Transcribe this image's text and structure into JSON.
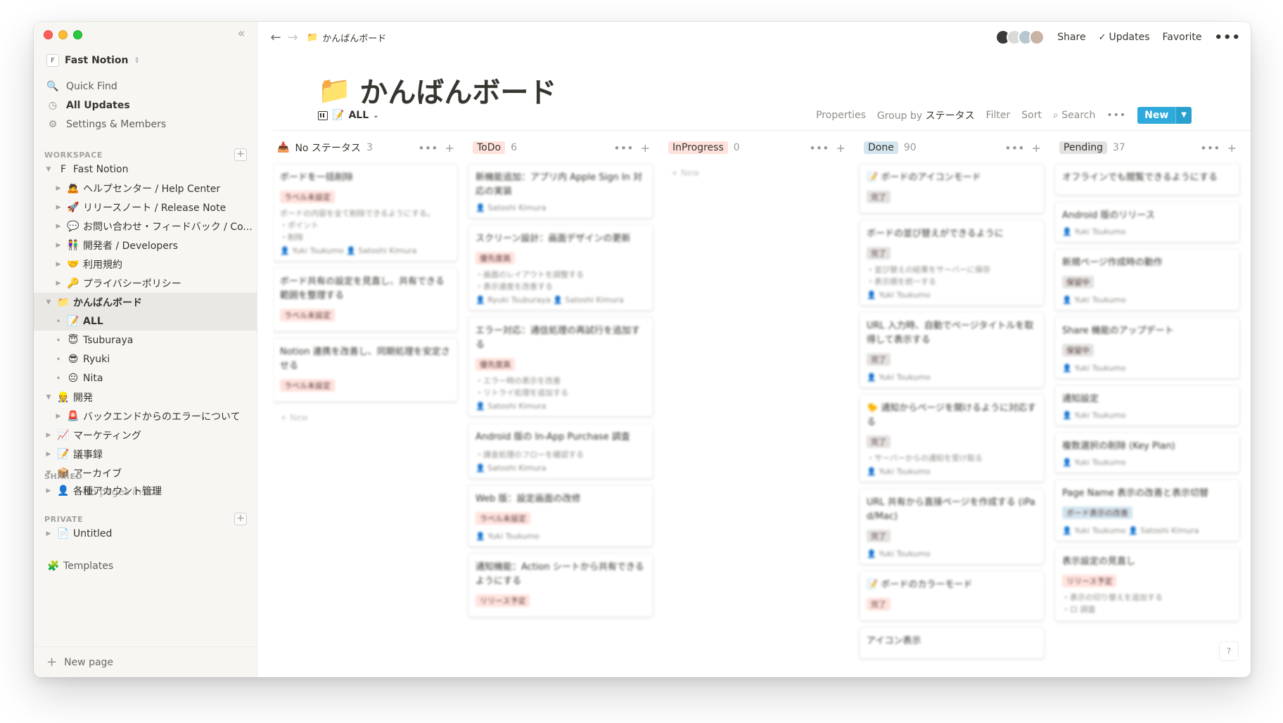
{
  "sidebar": {
    "workspace_name": "Fast Notion",
    "nav": [
      {
        "icon": "search-icon",
        "glyph": "🔍",
        "label": "Quick Find",
        "active": false
      },
      {
        "icon": "clock-icon",
        "glyph": "◷",
        "label": "All Updates",
        "active": true
      },
      {
        "icon": "gear-icon",
        "glyph": "⚙",
        "label": "Settings & Members",
        "active": false
      }
    ],
    "workspace_label": "WORKSPACE",
    "shared_label": "SHARED",
    "private_label": "PRIVATE",
    "tree": [
      {
        "level": 0,
        "toggle": "▼",
        "icon": "F",
        "label": "Fast Notion"
      },
      {
        "level": 1,
        "toggle": "▶",
        "icon": "🙇",
        "label": "ヘルプセンター / Help Center"
      },
      {
        "level": 1,
        "toggle": "▶",
        "icon": "🚀",
        "label": "リリースノート / Release Note"
      },
      {
        "level": 1,
        "toggle": "▶",
        "icon": "💬",
        "label": "お問い合わせ・フィードバック / Co..."
      },
      {
        "level": 1,
        "toggle": "▶",
        "icon": "👫",
        "label": "開発者 / Developers"
      },
      {
        "level": 1,
        "toggle": "▶",
        "icon": "🤝",
        "label": "利用規約"
      },
      {
        "level": 1,
        "toggle": "▶",
        "icon": "🔑",
        "label": "プライバシーポリシー"
      },
      {
        "level": 0,
        "toggle": "▼",
        "icon": "📁",
        "label": "かんばんボード",
        "bold": true,
        "selected": true
      },
      {
        "level": 1,
        "bullet": true,
        "icon": "📝",
        "label": "ALL",
        "bold": true,
        "selected": true
      },
      {
        "level": 1,
        "bullet": true,
        "icon": "😇",
        "label": "Tsuburaya"
      },
      {
        "level": 1,
        "bullet": true,
        "icon": "😎",
        "label": "Ryuki"
      },
      {
        "level": 1,
        "bullet": true,
        "icon": "😐",
        "label": "Nita"
      },
      {
        "level": 0,
        "toggle": "▼",
        "icon": "👷",
        "label": "開発"
      },
      {
        "level": 1,
        "toggle": "▶",
        "icon": "🚨",
        "label": "バックエンドからのエラーについて"
      },
      {
        "level": 0,
        "toggle": "▶",
        "icon": "📈",
        "label": "マーケティング"
      },
      {
        "level": 0,
        "toggle": "▶",
        "icon": "📝",
        "label": "議事録"
      },
      {
        "level": 0,
        "toggle": "▼",
        "icon": "📦",
        "label": "アーカイブ"
      },
      {
        "level": 1,
        "icon": "",
        "label": "No pages inside",
        "muted": true
      }
    ],
    "shared": [
      {
        "level": 0,
        "toggle": "▶",
        "icon": "👤",
        "label": "各種アカウント管理"
      }
    ],
    "private": [
      {
        "level": 0,
        "toggle": "▶",
        "icon": "📄",
        "label": "Untitled"
      }
    ],
    "templates_label": "Templates",
    "new_page_label": "New page"
  },
  "topbar": {
    "breadcrumb_icon": "📁",
    "breadcrumb": "かんばんボード",
    "share": "Share",
    "updates": "Updates",
    "favorite": "Favorite",
    "more": "•••"
  },
  "page": {
    "icon": "📁",
    "title": "かんばんボード"
  },
  "viewbar": {
    "view_icon": "📝",
    "view_name": "ALL",
    "properties": "Properties",
    "group_by_prefix": "Group by",
    "group_by_value": "ステータス",
    "filter": "Filter",
    "sort": "Sort",
    "search": "Search",
    "more": "•••",
    "new": "New"
  },
  "colors": {
    "accent": "#2eaadc",
    "sidebar_bg": "#f7f6f3",
    "tag_red": "#ffe2dd",
    "tag_blue": "#d3e5ef",
    "tag_gray": "#e3e2e0"
  },
  "board": {
    "columns": [
      {
        "name": "No ステータス",
        "count": "3",
        "tag_color": "transparent",
        "icon": "📥",
        "cards": [
          {
            "title": "ボードを一括削除",
            "tags": [
              {
                "text": "ラベル未設定",
                "color": "#ffe2dd"
              }
            ],
            "lines": [
              "ボードの内容を全て削除できるようにする。",
              "・ポイント",
              "・削除"
            ],
            "people": "👤 Yuki Tsukumo  👤 Satoshi Kimura"
          },
          {
            "title": "ボード共有の設定を見直し、共有できる範囲を整理する",
            "tags": [
              {
                "text": "ラベル未設定",
                "color": "#ffe2dd"
              }
            ],
            "lines": [],
            "people": ""
          },
          {
            "title": "Notion 連携を改善し、同期処理を安定させる",
            "tags": [
              {
                "text": "ラベル未設定",
                "color": "#ffe2dd"
              }
            ],
            "lines": [],
            "people": ""
          }
        ],
        "footer": "+ New"
      },
      {
        "name": "ToDo",
        "count": "6",
        "tag_color": "#ffe2dd",
        "icon": "",
        "cards": [
          {
            "title": "新機能追加：アプリ内 Apple Sign In 対応の実装",
            "tags": [],
            "lines": [],
            "people": "👤 Satoshi Kimura"
          },
          {
            "title": "スクリーン設計：画面デザインの更新",
            "tags": [
              {
                "text": "優先度高",
                "color": "#ffe2dd"
              }
            ],
            "lines": [
              "・画面のレイアウトを調整する",
              "・表示速度を改善する"
            ],
            "people": "👤 Ryuki Tsuburaya  👤 Satoshi Kimura"
          },
          {
            "title": "エラー対応：通信処理の再試行を追加する",
            "tags": [
              {
                "text": "優先度高",
                "color": "#ffe2dd"
              }
            ],
            "lines": [
              "・エラー時の表示を改善",
              "・リトライ処理を追加する"
            ],
            "people": "👤 Satoshi Kimura"
          },
          {
            "title": "Android 版の In-App Purchase 調査",
            "tags": [],
            "lines": [
              "・課金処理のフローを確認する"
            ],
            "people": "👤 Satoshi Kimura"
          },
          {
            "title": "Web 版：設定画面の改修",
            "tags": [
              {
                "text": "ラベル未設定",
                "color": "#ffe2dd"
              }
            ],
            "lines": [],
            "people": "👤 Yuki Tsukumo"
          },
          {
            "title": "通知機能：Action シートから共有できるようにする",
            "tags": [
              {
                "text": "リリース予定",
                "color": "#ffe2dd"
              }
            ],
            "lines": [],
            "people": ""
          }
        ],
        "footer": ""
      },
      {
        "name": "InProgress",
        "count": "0",
        "tag_color": "#ffe2dd",
        "icon": "",
        "cards": [],
        "footer": "+ New"
      },
      {
        "name": "Done",
        "count": "90",
        "tag_color": "#d3e5ef",
        "icon": "",
        "cards": [
          {
            "title": "📝 ボードのアイコンモード",
            "tags": [
              {
                "text": "完了",
                "color": "#e3e2e0"
              }
            ],
            "lines": [],
            "people": ""
          },
          {
            "title": "ボードの並び替えができるように",
            "tags": [
              {
                "text": "完了",
                "color": "#e3e2e0"
              }
            ],
            "lines": [
              "・並び替えの結果をサーバーに保存",
              "・表示順を統一する"
            ],
            "people": "👤 Yuki Tsukumo"
          },
          {
            "title": "URL 入力時、自動でページタイトルを取得して表示する",
            "tags": [
              {
                "text": "完了",
                "color": "#e3e2e0"
              }
            ],
            "lines": [],
            "people": "👤 Yuki Tsukumo"
          },
          {
            "title": "🐤 通知からページを開けるように対応する",
            "tags": [
              {
                "text": "完了",
                "color": "#e3e2e0"
              }
            ],
            "lines": [
              "・サーバーからの通知を受け取る"
            ],
            "people": "👤 Yuki Tsukumo"
          },
          {
            "title": "URL 共有から直接ページを作成する (iPad/Mac)",
            "tags": [
              {
                "text": "完了",
                "color": "#e3e2e0"
              }
            ],
            "lines": [],
            "people": "👤 Yuki Tsukumo"
          },
          {
            "title": "📝 ボードのカラーモード",
            "tags": [
              {
                "text": "完了",
                "color": "#ffe2dd"
              }
            ],
            "lines": [],
            "people": ""
          },
          {
            "title": "アイコン表示",
            "tags": [],
            "lines": [],
            "people": ""
          }
        ],
        "footer": ""
      },
      {
        "name": "Pending",
        "count": "37",
        "tag_color": "#e3e2e0",
        "icon": "",
        "cards": [
          {
            "title": "オフラインでも閲覧できるようにする",
            "tags": [],
            "lines": [],
            "people": ""
          },
          {
            "title": "Android 版のリリース",
            "tags": [],
            "lines": [],
            "people": "👤 Yuki Tsukumo"
          },
          {
            "title": "新規ページ作成時の動作",
            "tags": [
              {
                "text": "保留中",
                "color": "#e3e2e0"
              }
            ],
            "lines": [],
            "people": "👤 Yuki Tsukumo"
          },
          {
            "title": "Share 機能のアップデート",
            "tags": [
              {
                "text": "保留中",
                "color": "#e3e2e0"
              }
            ],
            "lines": [],
            "people": "👤 Yuki Tsukumo"
          },
          {
            "title": "通知設定",
            "tags": [],
            "lines": [],
            "people": "👤 Yuki Tsukumo"
          },
          {
            "title": "複数選択の削除 (Key Plan)",
            "tags": [],
            "lines": [],
            "people": "👤 Yuki Tsukumo"
          },
          {
            "title": "Page Name 表示の改善と表示切替",
            "tags": [
              {
                "text": "ボード表示の改善",
                "color": "#d3e5ef"
              }
            ],
            "lines": [],
            "people": "👤 Yuki Tsukumo  👤 Satoshi Kimura"
          },
          {
            "title": "表示設定の見直し",
            "tags": [
              {
                "text": "リリース予定",
                "color": "#ffe2dd"
              }
            ],
            "lines": [
              "・表示の切り替えを追加する",
              "・ロ 調査"
            ],
            "people": ""
          }
        ],
        "footer": ""
      }
    ]
  }
}
